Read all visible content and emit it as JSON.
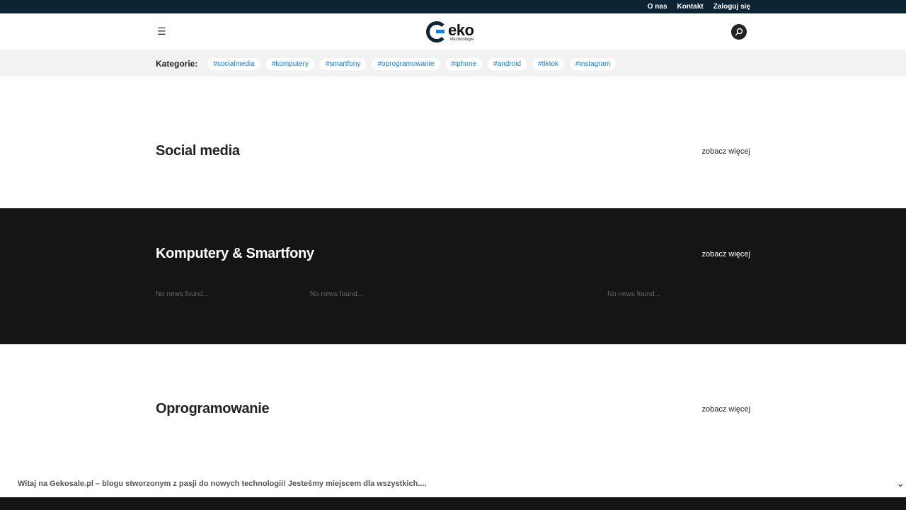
{
  "topbar": {
    "links": [
      "O nas",
      "Kontakt",
      "Zaloguj się"
    ]
  },
  "header": {
    "menu_icon": "☰",
    "logo": {
      "name": "eko",
      "tagline": "#technologie"
    },
    "search_icon": "search-icon"
  },
  "categories": {
    "label": "Kategorie:",
    "tags": [
      "#socialmedia",
      "#komputery",
      "#smartfony",
      "#oprogramowanie",
      "#iphone",
      "#android",
      "#tiktok",
      "#instagram"
    ]
  },
  "sections": [
    {
      "title": "Social media",
      "more": "zobacz więcej"
    },
    {
      "title": "Komputery & Smartfony",
      "more": "zobacz więcej",
      "empty": [
        "No news found...",
        "No news found...",
        "No news found..."
      ]
    },
    {
      "title": "Oprogramowanie",
      "more": "zobacz więcej"
    }
  ],
  "cookie": {
    "text": "Witaj na Gekosale.pl – blogu stworzonym z pasji do nowych technologii! Jesteśmy miejscem dla wszystkich....",
    "chevron": "⌄"
  },
  "colors": {
    "topbar": "#0d2434",
    "tag_text": "#1f78c4",
    "dark_section": "#151515"
  }
}
